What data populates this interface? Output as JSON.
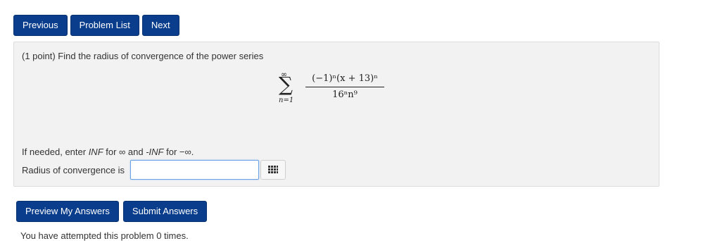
{
  "nav": {
    "previous_label": "Previous",
    "problem_list_label": "Problem List",
    "next_label": "Next"
  },
  "problem": {
    "prompt": "(1 point) Find the radius of convergence of the power series",
    "formula": {
      "sum_upper": "∞",
      "sum_symbol": "∑",
      "sum_lower": "n=1",
      "numerator": "(−1)ⁿ(x + 13)ⁿ",
      "denominator": "16ⁿn⁹"
    },
    "hint_prefix": "If needed, enter ",
    "hint_inf": "INF",
    "hint_for1": " for ∞ and ",
    "hint_neginf": "-INF",
    "hint_for2": " for −∞.",
    "answer_label": "Radius of convergence is",
    "answer_value": ""
  },
  "actions": {
    "preview_label": "Preview My Answers",
    "submit_label": "Submit Answers"
  },
  "footer_text": "You have attempted this problem 0 times.",
  "colors": {
    "button_bg": "#0a3e8c",
    "panel_bg": "#f2f2f2",
    "input_border": "#6aa0e6"
  },
  "icons": {
    "palette": "grid-palette-icon"
  }
}
